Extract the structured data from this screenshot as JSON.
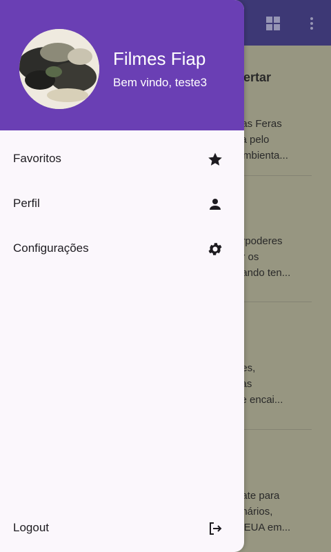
{
  "app_background": {
    "title_fragment": "pertar",
    "blocks": [
      [
        "das Feras",
        "ca pelo",
        "Ambienta..."
      ],
      [
        "erpoderes",
        "ar os",
        "uando ten..."
      ],
      [
        "nes,",
        "cas",
        "se encai..."
      ],
      [
        "gate para",
        "onários,",
        "s EUA em..."
      ]
    ]
  },
  "drawer": {
    "header": {
      "title": "Filmes Fiap",
      "subtitle": "Bem vindo, teste3",
      "avatar": "user-photo"
    },
    "items": [
      {
        "label": "Favoritos",
        "icon": "star-icon"
      },
      {
        "label": "Perfil",
        "icon": "person-icon"
      },
      {
        "label": "Configurações",
        "icon": "gear-icon"
      }
    ],
    "logout": {
      "label": "Logout",
      "icon": "logout-icon"
    }
  },
  "colors": {
    "header": "#6a3fb4",
    "drawer_bg": "#fbf7fc",
    "appbar": "#3f3a78"
  }
}
